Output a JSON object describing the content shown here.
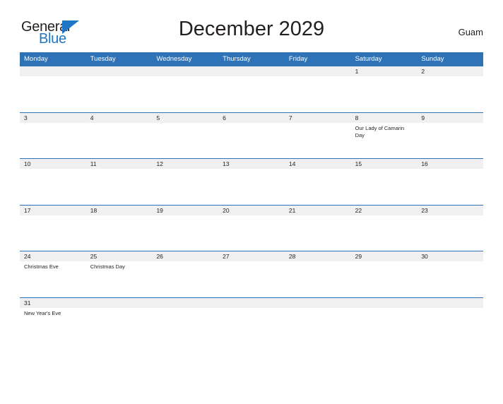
{
  "brand": {
    "name_part1": "General",
    "name_part2": "Blue",
    "flag_icon": "triangle-flag-icon",
    "colors": {
      "text_dark": "#231f20",
      "blue": "#1f76c4"
    }
  },
  "header": {
    "title": "December 2029",
    "locale": "Guam"
  },
  "colors": {
    "header_blue": "#2e72b8",
    "row_band_gray": "#f0f0f0",
    "page_background": "#ffffff",
    "text": "#231f20"
  },
  "calendar": {
    "month": "December",
    "year": "2029",
    "weekday_headers": [
      "Monday",
      "Tuesday",
      "Wednesday",
      "Thursday",
      "Friday",
      "Saturday",
      "Sunday"
    ],
    "weeks": [
      {
        "days": [
          {
            "num": "",
            "event": ""
          },
          {
            "num": "",
            "event": ""
          },
          {
            "num": "",
            "event": ""
          },
          {
            "num": "",
            "event": ""
          },
          {
            "num": "",
            "event": ""
          },
          {
            "num": "1",
            "event": ""
          },
          {
            "num": "2",
            "event": ""
          }
        ]
      },
      {
        "days": [
          {
            "num": "3",
            "event": ""
          },
          {
            "num": "4",
            "event": ""
          },
          {
            "num": "5",
            "event": ""
          },
          {
            "num": "6",
            "event": ""
          },
          {
            "num": "7",
            "event": ""
          },
          {
            "num": "8",
            "event": "Our Lady of Camarin Day"
          },
          {
            "num": "9",
            "event": ""
          }
        ]
      },
      {
        "days": [
          {
            "num": "10",
            "event": ""
          },
          {
            "num": "11",
            "event": ""
          },
          {
            "num": "12",
            "event": ""
          },
          {
            "num": "13",
            "event": ""
          },
          {
            "num": "14",
            "event": ""
          },
          {
            "num": "15",
            "event": ""
          },
          {
            "num": "16",
            "event": ""
          }
        ]
      },
      {
        "days": [
          {
            "num": "17",
            "event": ""
          },
          {
            "num": "18",
            "event": ""
          },
          {
            "num": "19",
            "event": ""
          },
          {
            "num": "20",
            "event": ""
          },
          {
            "num": "21",
            "event": ""
          },
          {
            "num": "22",
            "event": ""
          },
          {
            "num": "23",
            "event": ""
          }
        ]
      },
      {
        "days": [
          {
            "num": "24",
            "event": "Christmas Eve"
          },
          {
            "num": "25",
            "event": "Christmas Day"
          },
          {
            "num": "26",
            "event": ""
          },
          {
            "num": "27",
            "event": ""
          },
          {
            "num": "28",
            "event": ""
          },
          {
            "num": "29",
            "event": ""
          },
          {
            "num": "30",
            "event": ""
          }
        ]
      },
      {
        "days": [
          {
            "num": "31",
            "event": "New Year's Eve"
          },
          {
            "num": "",
            "event": ""
          },
          {
            "num": "",
            "event": ""
          },
          {
            "num": "",
            "event": ""
          },
          {
            "num": "",
            "event": ""
          },
          {
            "num": "",
            "event": ""
          },
          {
            "num": "",
            "event": ""
          }
        ]
      }
    ]
  }
}
